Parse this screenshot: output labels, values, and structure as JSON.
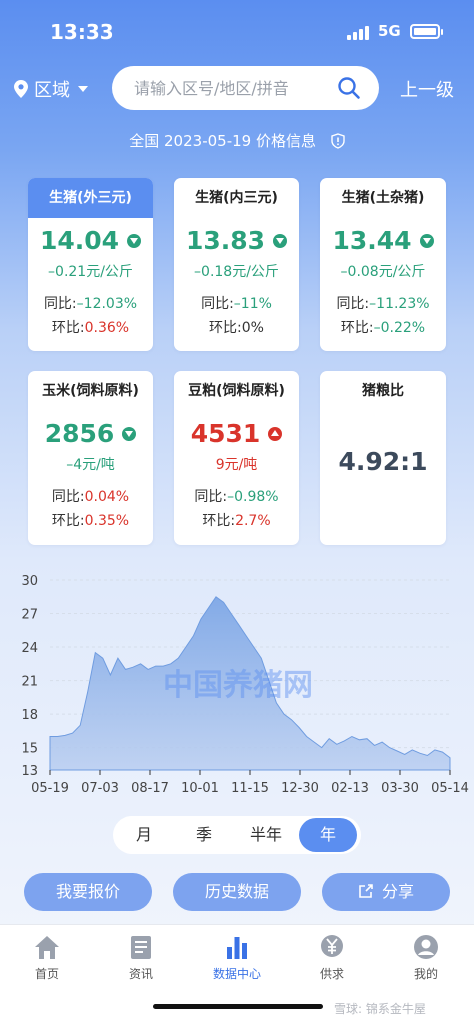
{
  "status": {
    "time": "13:33",
    "network": "5G"
  },
  "topbar": {
    "region_label": "区域",
    "search_placeholder": "请输入区号/地区/拼音",
    "up_level": "上一级"
  },
  "info_line": "全国 2023-05-19 价格信息",
  "cards": [
    {
      "title": "生猪(外三元)",
      "price": "14.04",
      "direction": "down",
      "change": "–0.21元/公斤",
      "yoy": "同比:–12.03%",
      "mom": "环比:0.36%",
      "active": true
    },
    {
      "title": "生猪(内三元)",
      "price": "13.83",
      "direction": "down",
      "change": "–0.18元/公斤",
      "yoy": "同比:–11%",
      "mom": "环比:0%"
    },
    {
      "title": "生猪(土杂猪)",
      "price": "13.44",
      "direction": "down",
      "change": "–0.08元/公斤",
      "yoy": "同比:–11.23%",
      "mom": "环比:–0.22%"
    },
    {
      "title": "玉米(饲料原料)",
      "price": "2856",
      "direction": "down",
      "change": "–4元/吨",
      "yoy": "同比:0.04%",
      "mom": "环比:0.35%"
    },
    {
      "title": "豆粕(饲料原料)",
      "price": "4531",
      "direction": "up",
      "change": "9元/吨",
      "yoy": "同比:–0.98%",
      "mom": "环比:2.7%"
    },
    {
      "title": "猪粮比",
      "value": "4.92:1"
    }
  ],
  "colors": {
    "accent": "#5b8ef0",
    "green": "#2aa07b",
    "red": "#d9342b"
  },
  "chart_data": {
    "type": "area",
    "watermark": "中国养猪网",
    "y_ticks": [
      "30",
      "27",
      "24",
      "21",
      "18",
      "15",
      "13"
    ],
    "x_ticks": [
      "05-19",
      "07-03",
      "08-17",
      "10-01",
      "11-15",
      "12-30",
      "02-13",
      "03-30",
      "05-14"
    ],
    "ylim": [
      13,
      30
    ],
    "grid": true,
    "x": [
      "05-19",
      "05-26",
      "06-02",
      "06-09",
      "06-16",
      "06-23",
      "06-30",
      "07-03",
      "07-07",
      "07-14",
      "07-21",
      "07-28",
      "08-04",
      "08-11",
      "08-17",
      "08-24",
      "08-31",
      "09-07",
      "09-14",
      "09-21",
      "09-28",
      "10-01",
      "10-05",
      "10-12",
      "10-19",
      "10-26",
      "11-02",
      "11-09",
      "11-15",
      "11-22",
      "11-29",
      "12-06",
      "12-13",
      "12-20",
      "12-30",
      "01-06",
      "01-13",
      "01-20",
      "01-27",
      "02-03",
      "02-13",
      "02-20",
      "02-27",
      "03-06",
      "03-13",
      "03-20",
      "03-30",
      "04-06",
      "04-13",
      "04-20",
      "04-27",
      "05-04",
      "05-14",
      "05-19"
    ],
    "values": [
      16.0,
      16.0,
      16.1,
      16.3,
      17.0,
      20.0,
      23.5,
      23.0,
      21.5,
      23.0,
      22.0,
      22.2,
      22.5,
      22.0,
      22.3,
      22.3,
      22.5,
      23.0,
      24.0,
      25.0,
      26.5,
      27.5,
      28.5,
      28.0,
      27.0,
      26.0,
      25.0,
      24.0,
      23.0,
      21.0,
      19.0,
      18.0,
      17.5,
      16.8,
      16.0,
      15.5,
      15.0,
      15.8,
      15.3,
      15.6,
      16.0,
      15.7,
      15.8,
      15.2,
      15.5,
      15.0,
      14.7,
      14.4,
      14.8,
      14.5,
      14.3,
      14.8,
      14.6,
      14.1
    ]
  },
  "tabs": [
    "月",
    "季",
    "半年",
    "年"
  ],
  "active_tab": "年",
  "buttons": {
    "quote": "我要报价",
    "history": "历史数据",
    "share": "分享"
  },
  "nav": [
    {
      "label": "首页",
      "icon": "home-icon"
    },
    {
      "label": "资讯",
      "icon": "news-icon"
    },
    {
      "label": "数据中心",
      "icon": "bar-chart-icon"
    },
    {
      "label": "供求",
      "icon": "yuan-icon"
    },
    {
      "label": "我的",
      "icon": "user-icon"
    }
  ],
  "watermark_text": "雪球: 锦系金牛屋"
}
